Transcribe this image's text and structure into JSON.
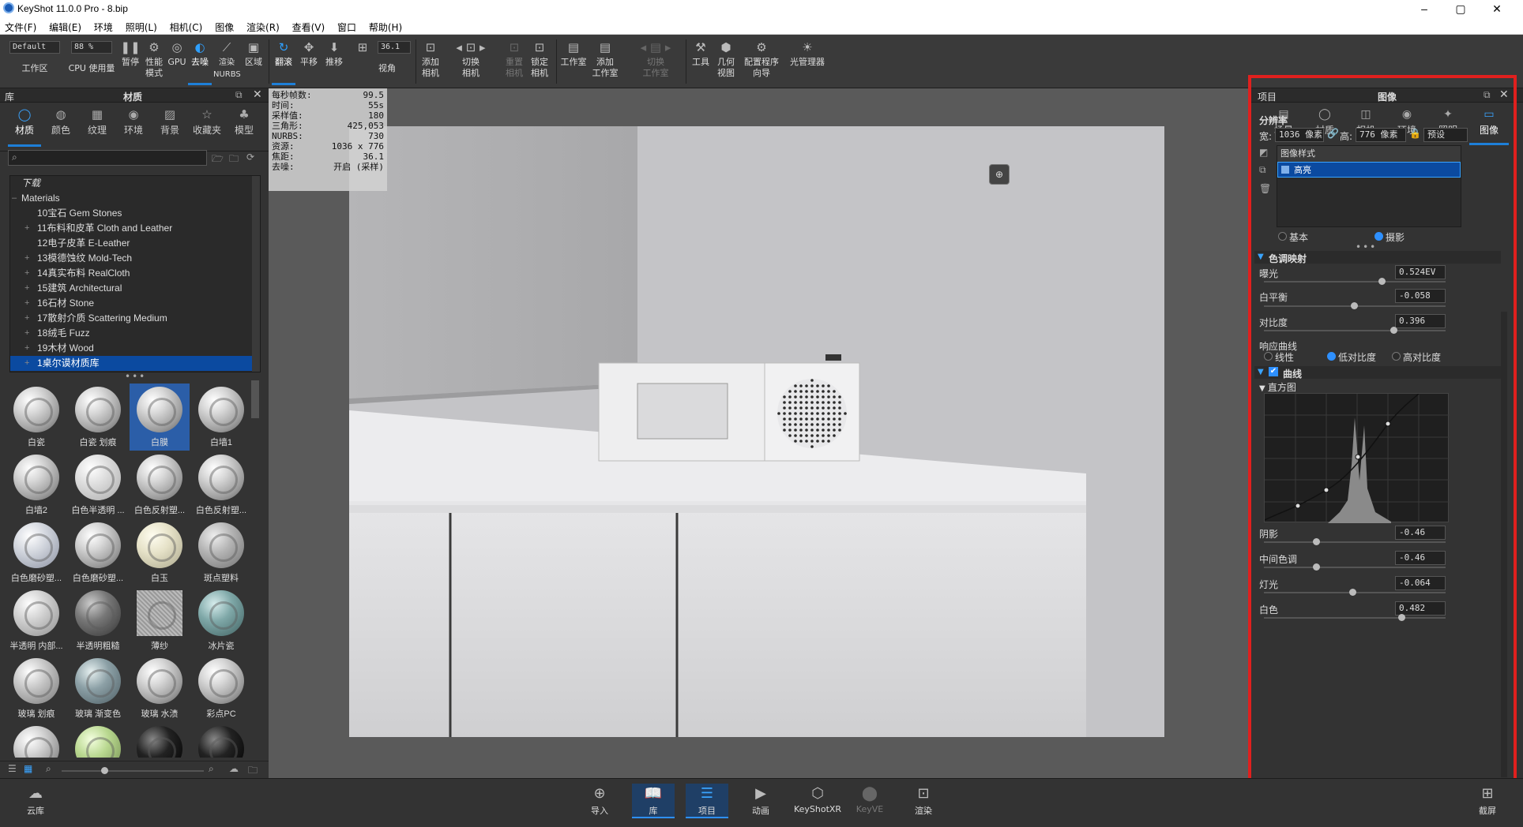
{
  "window": {
    "title": "KeyShot 11.0.0 Pro  - 8.bip",
    "min": "–",
    "max": "▢",
    "close": "✕"
  },
  "menu": [
    "文件(F)",
    "编辑(E)",
    "环境",
    "照明(L)",
    "相机(C)",
    "图像",
    "渲染(R)",
    "查看(V)",
    "窗口",
    "帮助(H)"
  ],
  "toolbar": {
    "workspace_value": "Default",
    "workspace_label": "工作区",
    "cpu_value": "88 %",
    "cpu_label": "CPU 使用量",
    "pause": "暂停",
    "perf": "性能\n模式",
    "gpu": "GPU",
    "denoise": "去噪",
    "render_nurbs": "渲染\nNURBS",
    "region": "区域",
    "tumble": "翻滚",
    "pan": "平移",
    "dolly": "推移",
    "fov_value": "36.1",
    "fov_label": "视角",
    "add_camera": "添加\n相机",
    "switch_camera": "切换\n相机",
    "reset_camera": "重置\n相机",
    "lock_camera": "锁定\n相机",
    "studio": "工作室",
    "add_studio": "添加\n工作室",
    "switch_studio": "切换\n工作室",
    "tools": "工具",
    "geometry_view": "几何\n视图",
    "config_wizard": "配置程序\n向导",
    "light_manager": "光管理器"
  },
  "library": {
    "header_left": "库",
    "header_title": "材质",
    "tabs": [
      {
        "label": "材质",
        "icon": "material-icon"
      },
      {
        "label": "颜色",
        "icon": "color-icon"
      },
      {
        "label": "纹理",
        "icon": "texture-icon"
      },
      {
        "label": "环境",
        "icon": "environment-icon"
      },
      {
        "label": "背景",
        "icon": "background-icon"
      },
      {
        "label": "收藏夹",
        "icon": "favorites-icon"
      },
      {
        "label": "模型",
        "icon": "model-icon"
      }
    ],
    "tree": [
      {
        "label": "下载",
        "plus": ""
      },
      {
        "label": "Materials",
        "plus": "–"
      },
      {
        "label": "10宝石 Gem Stones",
        "plus": ""
      },
      {
        "label": "11布料和皮革 Cloth and Leather",
        "plus": "+"
      },
      {
        "label": "12电子皮革 E-Leather",
        "plus": ""
      },
      {
        "label": "13模德蚀纹 Mold-Tech",
        "plus": "+"
      },
      {
        "label": "14真实布料 RealCloth",
        "plus": "+"
      },
      {
        "label": "15建筑 Architectural",
        "plus": "+"
      },
      {
        "label": "16石材 Stone",
        "plus": "+"
      },
      {
        "label": "17散射介质 Scattering Medium",
        "plus": "+"
      },
      {
        "label": "18绒毛 Fuzz",
        "plus": "+"
      },
      {
        "label": "19木材 Wood",
        "plus": "+"
      },
      {
        "label": "1桌尔谟材质库",
        "plus": "+"
      }
    ],
    "thumbs": [
      "白瓷",
      "白瓷 划痕",
      "白膜",
      "白墙1",
      "白墙2",
      "白色半透明 ...",
      "白色反射塑...",
      "白色反射塑...",
      "白色磨砂塑...",
      "白色磨砂塑...",
      "白玉",
      "斑点塑料",
      "半透明 内部...",
      "半透明粗糙",
      "薄纱",
      "冰片瓷",
      "玻璃 划痕",
      "玻璃 渐变色",
      "玻璃 水渍",
      "彩点PC",
      "",
      "",
      "",
      ""
    ]
  },
  "stats": [
    {
      "k": "每秒帧数:",
      "v": "99.5"
    },
    {
      "k": "时间:",
      "v": "55s"
    },
    {
      "k": "采样值:",
      "v": "180"
    },
    {
      "k": "三角形:",
      "v": "425,053"
    },
    {
      "k": "NURBS:",
      "v": "730"
    },
    {
      "k": "资源:",
      "v": "1036 x 776"
    },
    {
      "k": "焦距:",
      "v": "36.1"
    },
    {
      "k": "去噪:",
      "v": "开启 (采样)"
    }
  ],
  "project": {
    "header_left": "项目",
    "header_title": "图像",
    "tabs": [
      {
        "label": "场景",
        "icon": "scene-icon"
      },
      {
        "label": "材质",
        "icon": "material-icon"
      },
      {
        "label": "相机",
        "icon": "camera-icon"
      },
      {
        "label": "环境",
        "icon": "environment-icon"
      },
      {
        "label": "照明",
        "icon": "lighting-icon"
      },
      {
        "label": "图像",
        "icon": "image-icon"
      }
    ],
    "resolution_label": "分辨率",
    "width_label": "宽:",
    "width_value": "1036 像素",
    "height_label": "高:",
    "height_value": "776 像素",
    "preset": "预设",
    "style_header": "图像样式",
    "style_item": "高亮",
    "mode_basic": "基本",
    "mode_photo": "摄影",
    "tonemap_header": "色调映射",
    "exposure_label": "曝光",
    "exposure_value": "0.524EV",
    "whitebalance_label": "白平衡",
    "whitebalance_value": "-0.058",
    "contrast_label": "对比度",
    "contrast_value": "0.396",
    "response_label": "响应曲线",
    "resp_linear": "线性",
    "resp_low": "低对比度",
    "resp_high": "高对比度",
    "curve_header": "曲线",
    "histogram_label": "直方图",
    "shadows_label": "阴影",
    "shadows_value": "-0.46",
    "midtones_label": "中间色调",
    "midtones_value": "-0.46",
    "highlights_label": "灯光",
    "highlights_value": "-0.064",
    "whites_label": "白色",
    "whites_value": "0.482"
  },
  "bottombar": {
    "cloud": "云库",
    "import": "导入",
    "library": "库",
    "project": "项目",
    "animation": "动画",
    "keyshotxr": "KeyShotXR",
    "keyve": "KeyVE",
    "render": "渲染",
    "screenshot": "截屏"
  },
  "colors": {
    "accent": "#1e7fd8",
    "highlight_box": "#e0201e",
    "selection": "#0b4aa0"
  }
}
